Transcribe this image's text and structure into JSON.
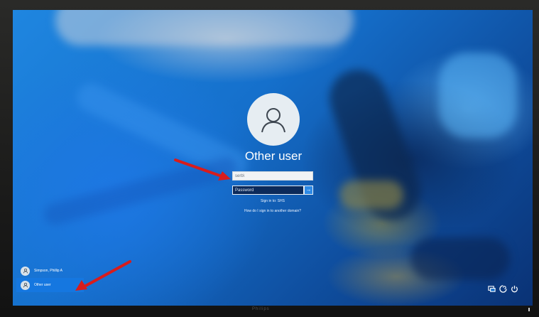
{
  "login": {
    "title": "Other user",
    "username_value": "serb\\",
    "password_placeholder": "Password",
    "submit_glyph": "→",
    "sign_in_to_link": "Sign in to: SHS",
    "domain_help_link": "How do I sign in to another domain?"
  },
  "users": [
    {
      "name": "Simpson, Phillip A",
      "selected": false
    },
    {
      "name": "Other user",
      "selected": true
    }
  ],
  "system_icons": [
    "network-icon",
    "ease-of-access-icon",
    "power-icon"
  ],
  "monitor": {
    "brand": "Philips"
  },
  "colors": {
    "background_blue": "#1570cc",
    "selected_user": "#1577e0",
    "password_field": "#0c2a5a",
    "submit_button": "#2e8ae6",
    "annotation_arrow": "#d81c1c"
  },
  "annotations": [
    "red-arrow-to-username",
    "red-arrow-to-other-user"
  ]
}
